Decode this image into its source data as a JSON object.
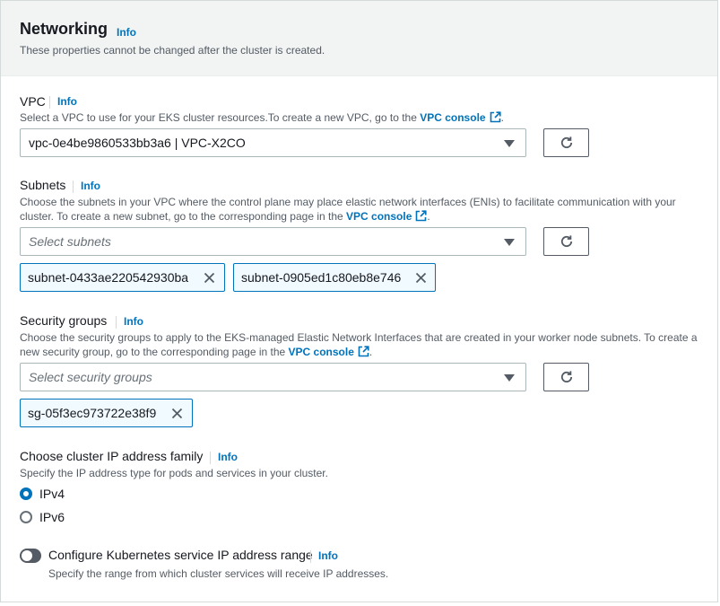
{
  "header": {
    "title": "Networking",
    "info": "Info",
    "description": "These properties cannot be changed after the cluster is created."
  },
  "vpc": {
    "label": "VPC",
    "info": "Info",
    "desc_prefix": "Select a VPC to use for your EKS cluster resources.To create a new VPC, go to the ",
    "link": "VPC console",
    "desc_suffix": ".",
    "selected": "vpc-0e4be9860533bb3a6 | VPC-X2CO"
  },
  "subnets": {
    "label": "Subnets",
    "info": "Info",
    "desc_prefix": "Choose the subnets in your VPC where the control plane may place elastic network interfaces (ENIs) to facilitate communication with your cluster. To create a new subnet, go to the corresponding page in the ",
    "link": "VPC console",
    "desc_suffix": ".",
    "placeholder": "Select subnets",
    "tokens": [
      "subnet-0433ae220542930ba",
      "subnet-0905ed1c80eb8e746"
    ]
  },
  "security_groups": {
    "label": "Security groups",
    "info": "Info",
    "desc_prefix": "Choose the security groups to apply to the EKS-managed Elastic Network Interfaces that are created in your worker node subnets. To create a new security group, go to the corresponding page in the ",
    "link": "VPC console",
    "desc_suffix": ".",
    "placeholder": "Select security groups",
    "tokens": [
      "sg-05f3ec973722e38f9"
    ]
  },
  "ip_family": {
    "label": "Choose cluster IP address family",
    "info": "Info",
    "description": "Specify the IP address type for pods and services in your cluster.",
    "options": [
      {
        "label": "IPv4",
        "checked": true
      },
      {
        "label": "IPv6",
        "checked": false
      }
    ]
  },
  "service_ip": {
    "label": "Configure Kubernetes service IP address range",
    "info": "Info",
    "description": "Specify the range from which cluster services will receive IP addresses.",
    "enabled": false
  },
  "colors": {
    "link": "#0073bb",
    "header_bg": "#f2f3f3",
    "token_bg": "#f1faff"
  },
  "icons": {
    "external": "external-link-icon",
    "refresh": "refresh-icon",
    "dismiss": "close-icon",
    "caret": "caret-down-icon"
  }
}
